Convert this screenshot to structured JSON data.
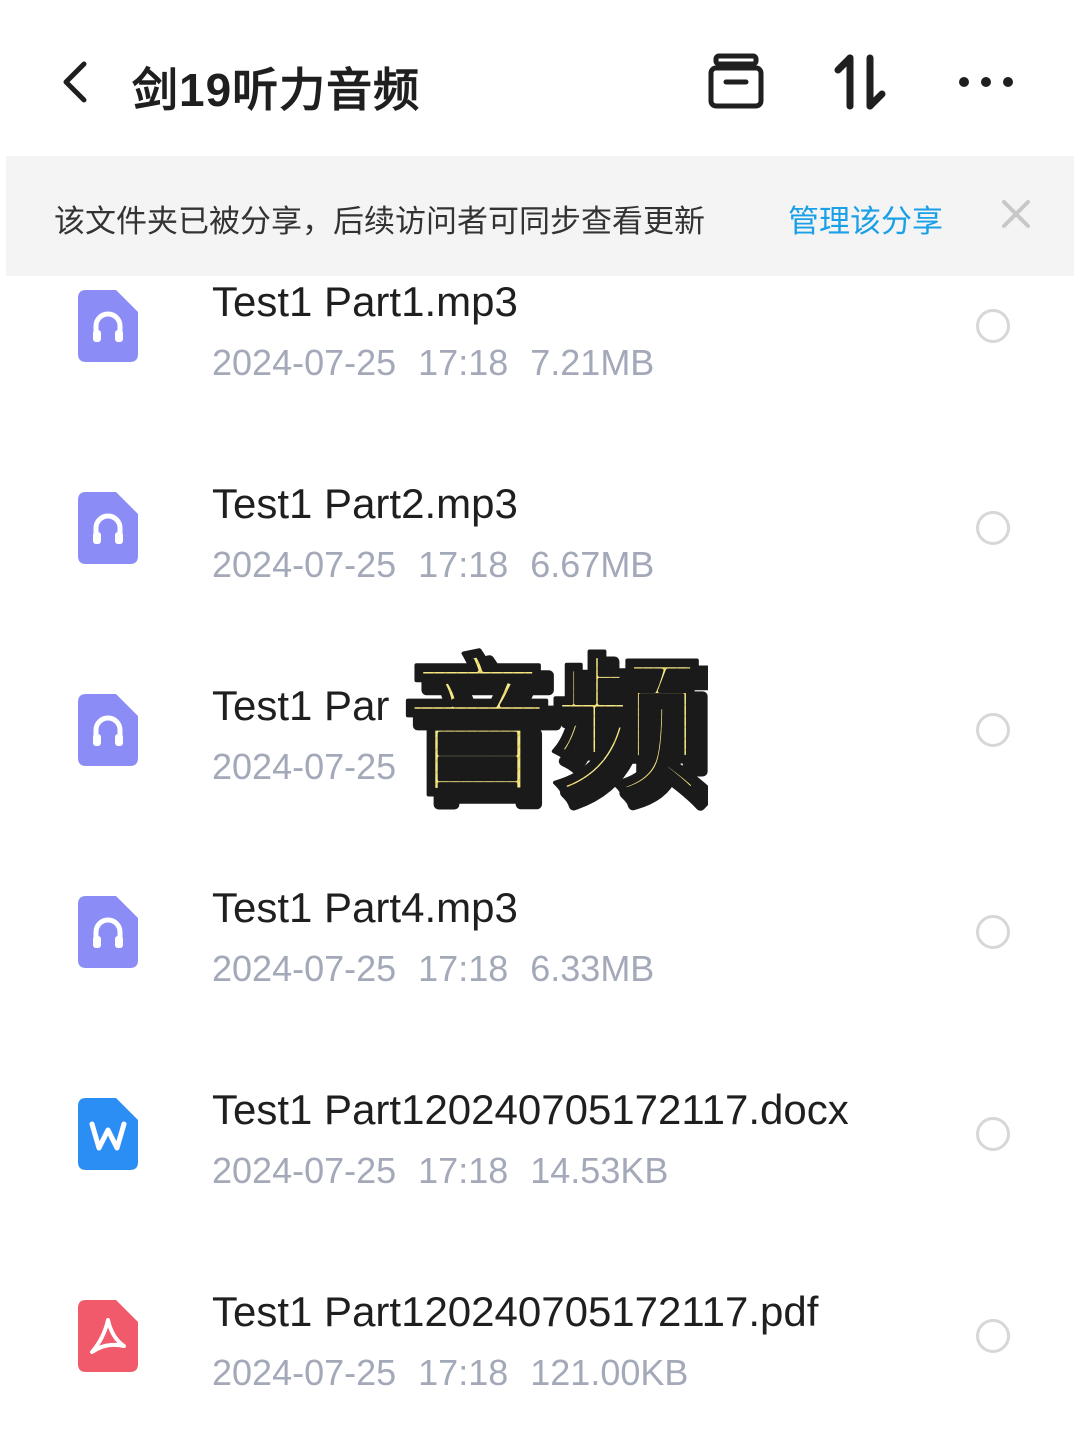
{
  "header": {
    "title": "剑19听力音频",
    "icons": [
      "back-icon",
      "collection-box-icon",
      "sort-icon",
      "more-icon"
    ]
  },
  "banner": {
    "message": "该文件夹已被分享，后续访问者可同步查看更新",
    "manage_link": "管理该分享",
    "link_color": "#1aa0e6"
  },
  "files": [
    {
      "name": "Test1 Part1.mp3",
      "date": "2024-07-25",
      "time": "17:18",
      "size": "7.21MB",
      "type": "audio"
    },
    {
      "name": "Test1 Part2.mp3",
      "date": "2024-07-25",
      "time": "17:18",
      "size": "6.67MB",
      "type": "audio"
    },
    {
      "name": "Test1 Par",
      "date": "2024-07-25",
      "time": "",
      "size": "",
      "type": "audio"
    },
    {
      "name": "Test1 Part4.mp3",
      "date": "2024-07-25",
      "time": "17:18",
      "size": "6.33MB",
      "type": "audio"
    },
    {
      "name": "Test1 Part120240705172117.docx",
      "date": "2024-07-25",
      "time": "17:18",
      "size": "14.53KB",
      "type": "word"
    },
    {
      "name": "Test1 Part120240705172117.pdf",
      "date": "2024-07-25",
      "time": "17:18",
      "size": "121.00KB",
      "type": "pdf"
    }
  ],
  "overlay": {
    "text": "音频",
    "fill_color": "#f5e88a",
    "stroke_color": "#1a1a1a"
  },
  "colors": {
    "audio_icon": "#8b8cf5",
    "word_icon": "#2b8ef5",
    "pdf_icon": "#f05a6a",
    "meta_text": "#a3a9b8"
  }
}
